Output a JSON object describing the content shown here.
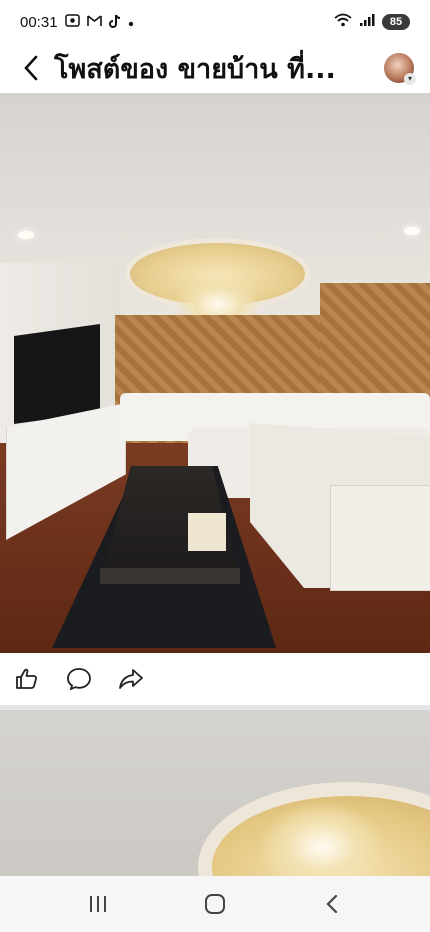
{
  "status_bar": {
    "time": "00:31",
    "app_icons": [
      "screen-record-icon",
      "gmail-icon",
      "tiktok-icon",
      "dot-icon"
    ],
    "right_icons": [
      "wifi-icon",
      "signal-icon"
    ],
    "battery_level": "85"
  },
  "header": {
    "title": "โพสต์ของ ขายบ้าน ที่...",
    "back_icon": "chevron-left-icon",
    "avatar_icon": "avatar-icon"
  },
  "post": {
    "photo1_desc_icon": "living-room-photo",
    "actions": [
      "like-icon",
      "comment-icon",
      "share-icon"
    ],
    "photo2_desc_icon": "ceiling-photo"
  },
  "nav_bar": [
    "recent-apps-icon",
    "home-icon",
    "back-icon"
  ],
  "colors": {
    "battery_bg": "#3a3a3a",
    "divider": "#e5e5e8",
    "nav_bg": "#f6f6f7"
  }
}
